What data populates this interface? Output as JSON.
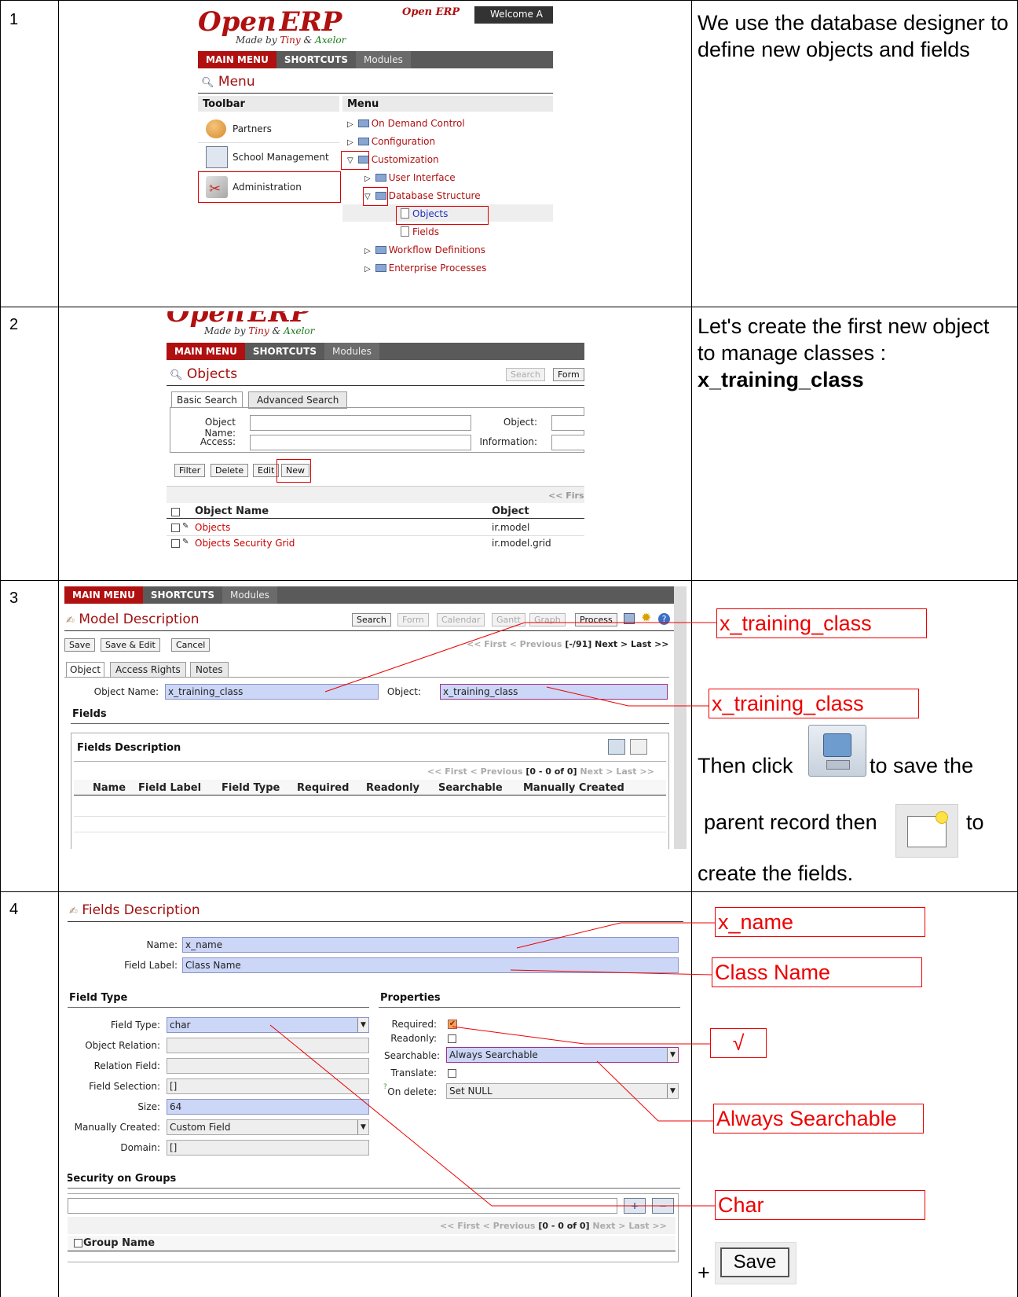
{
  "rows": [
    {
      "num": "1",
      "note": "We use the database designer to define new objects and fields"
    },
    {
      "num": "2",
      "note_pre": "Let's create the first new object to manage classes :",
      "note_bold": "x_training_class"
    },
    {
      "num": "3",
      "note_a": "Then click",
      "note_b": "to save the",
      "note_c": "parent record then",
      "note_d": "to",
      "note_e": "create the fields."
    },
    {
      "num": "4",
      "note_plus": "+",
      "save_label": "Save"
    }
  ],
  "logo": {
    "open": "Open",
    "erp": "ERP",
    "madeby": "Made by",
    "tiny": "Tiny",
    "amp": "&",
    "axelor": "Axelor",
    "welcome": "Welcome A"
  },
  "nav": {
    "main_menu": "MAIN MENU",
    "shortcuts": "SHORTCUTS",
    "modules": "Modules"
  },
  "shot1": {
    "title": "Menu",
    "toolbar_header": "Toolbar",
    "menu_header": "Menu",
    "toolbar": [
      "Partners",
      "School Management",
      "Administration"
    ],
    "menu": [
      "On Demand Control",
      "Configuration",
      "Customization",
      "User Interface",
      "Database Structure",
      "Objects",
      "Fields",
      "Workflow Definitions",
      "Enterprise Processes"
    ]
  },
  "shot2": {
    "title": "Objects",
    "search_btn": "Search",
    "form_btn": "Form",
    "tab_basic": "Basic Search",
    "tab_adv": "Advanced Search",
    "object_name_lbl": "Object Name:",
    "object_lbl": "Object:",
    "access_lbl": "Access:",
    "information_lbl": "Information:",
    "buttons": [
      "Filter",
      "Delete",
      "Edit",
      "New"
    ],
    "pager": "<< Firs",
    "col_name": "Object Name",
    "col_object": "Object",
    "rows": [
      {
        "name": "Objects",
        "object": "ir.model"
      },
      {
        "name": "Objects Security Grid",
        "object": "ir.model.grid"
      }
    ]
  },
  "shot3": {
    "title": "Model Description",
    "views": [
      "Search",
      "Form",
      "Calendar",
      "Gantt",
      "Graph",
      "Process"
    ],
    "actions": [
      "Save",
      "Save & Edit",
      "Cancel"
    ],
    "pager_pre": "<< First < Previous",
    "pager_count": "[-/91]",
    "pager_post": "Next > Last >>",
    "tabs": [
      "Object",
      "Access Rights",
      "Notes"
    ],
    "object_name_lbl": "Object Name:",
    "object_name_val": "x_training_class",
    "object_lbl": "Object:",
    "object_val": "x_training_class",
    "fields_hdr": "Fields",
    "fields_desc": "Fields Description",
    "sub_pager_pre": "<< First < Previous",
    "sub_pager_count": "[0 - 0 of 0]",
    "sub_pager_post": "Next > Last >>",
    "cols": [
      "Name",
      "Field Label",
      "Field Type",
      "Required",
      "Readonly",
      "Searchable",
      "Manually Created"
    ]
  },
  "shot4": {
    "title": "Fields Description",
    "name_lbl": "Name:",
    "name_val": "x_name",
    "label_lbl": "Field Label:",
    "label_val": "Class Name",
    "field_type_hdr": "Field Type",
    "properties_hdr": "Properties",
    "ft_lbl": "Field Type:",
    "ft_val": "char",
    "obj_rel_lbl": "Object Relation:",
    "rel_field_lbl": "Relation Field:",
    "field_sel_lbl": "Field Selection:",
    "field_sel_val": "[]",
    "size_lbl": "Size:",
    "size_val": "64",
    "man_lbl": "Manually Created:",
    "man_val": "Custom Field",
    "domain_lbl": "Domain:",
    "domain_val": "[]",
    "req_lbl": "Required:",
    "ro_lbl": "Readonly:",
    "search_lbl": "Searchable:",
    "search_val": "Always Searchable",
    "translate_lbl": "Translate:",
    "ondelete_lbl": "On delete:",
    "ondelete_val": "Set NULL",
    "sec_hdr": "Security on Groups",
    "pager_pre": "<< First < Previous",
    "pager_count": "[0 - 0 of 0]",
    "pager_post": "Next > Last >>",
    "group_col": "Group Name"
  },
  "annotations": {
    "a1": "x_training_class",
    "a2": "x_training_class",
    "b1": "x_name",
    "b2": "Class Name",
    "b3": "√",
    "b4": "Always Searchable",
    "b5": "Char"
  }
}
